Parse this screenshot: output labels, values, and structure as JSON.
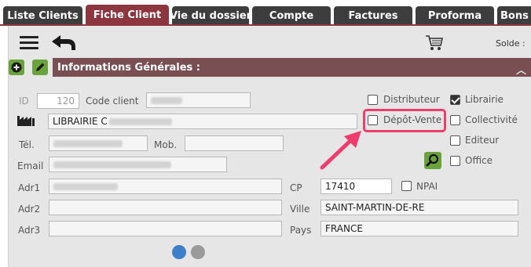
{
  "tabs": [
    {
      "label": "Liste Clients",
      "active": false
    },
    {
      "label": "Fiche Client",
      "active": true
    },
    {
      "label": "Vie du dossier",
      "active": false
    },
    {
      "label": "Compte",
      "active": false
    },
    {
      "label": "Factures",
      "active": false
    },
    {
      "label": "Proforma",
      "active": false
    },
    {
      "label": "Bons de",
      "active": false
    }
  ],
  "toolbar": {
    "solde_label": "Solde :"
  },
  "section": {
    "title": "Informations Générales :"
  },
  "form": {
    "id_label": "ID",
    "id_value": "120",
    "code_client_label": "Code client",
    "raison_sociale_value": "LIBRAIRIE C",
    "tel_label": "Tél.",
    "mob_label": "Mob.",
    "email_label": "Email",
    "adr1_label": "Adr1",
    "adr2_label": "Adr2",
    "adr3_label": "Adr3",
    "cp_label": "CP",
    "cp_value": "17410",
    "npai_label": "NPAI",
    "ville_label": "Ville",
    "ville_value": "SAINT-MARTIN-DE-RE",
    "pays_label": "Pays",
    "pays_value": "FRANCE"
  },
  "categories": {
    "distributeur": {
      "label": "Distributeur",
      "checked": false
    },
    "depot_vente": {
      "label": "Dépôt-Vente",
      "checked": false
    },
    "librairie": {
      "label": "Librairie",
      "checked": true
    },
    "collectivite": {
      "label": "Collectivité",
      "checked": false
    },
    "editeur": {
      "label": "Editeur",
      "checked": false
    },
    "office": {
      "label": "Office",
      "checked": false
    }
  },
  "colors": {
    "accent": "#8e3640",
    "section": "#7a4f54",
    "green": "#6aa33c",
    "highlight": "#ee3d6d"
  },
  "icons": [
    "hamburger-icon",
    "back-arrow-icon",
    "cart-icon",
    "plus-icon",
    "pencil-icon",
    "factory-icon",
    "search-icon",
    "chevron-up-icon"
  ]
}
